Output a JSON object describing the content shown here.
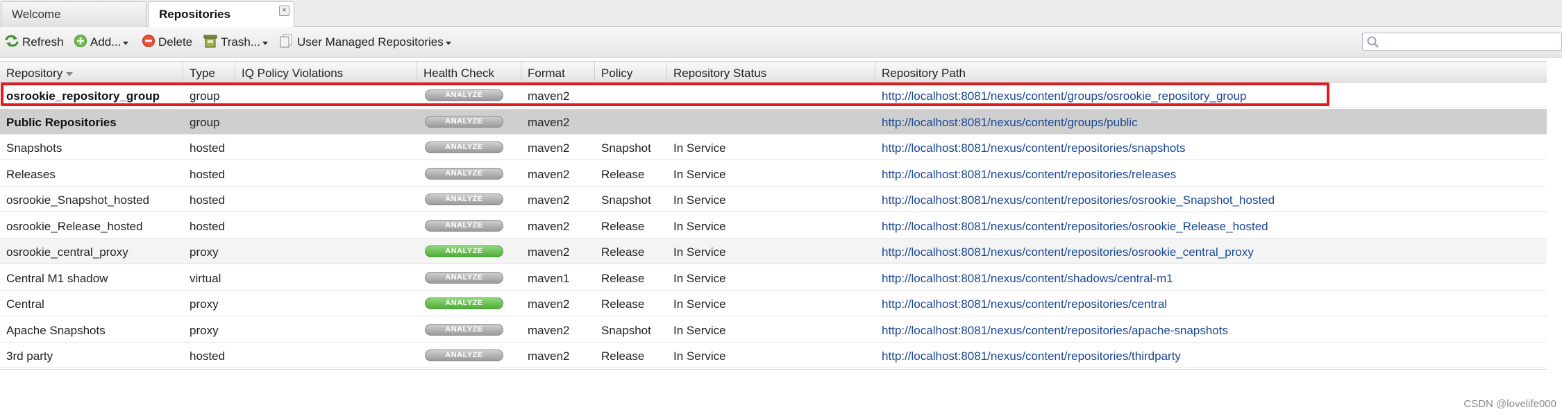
{
  "tabs": [
    {
      "label": "Welcome",
      "active": false
    },
    {
      "label": "Repositories",
      "active": true
    }
  ],
  "toolbar": {
    "refresh_label": "Refresh",
    "add_label": "Add...",
    "delete_label": "Delete",
    "trash_label": "Trash...",
    "user_managed_label": "User Managed Repositories",
    "search_placeholder": ""
  },
  "columns": {
    "repository": "Repository",
    "type": "Type",
    "iq": "IQ Policy Violations",
    "health": "Health Check",
    "format": "Format",
    "policy": "Policy",
    "status": "Repository Status",
    "path": "Repository Path"
  },
  "analyze_label": "ANALYZE",
  "rows": [
    {
      "name": "osrookie_repository_group",
      "type": "group",
      "health": "gray",
      "format": "maven2",
      "policy": "",
      "status": "",
      "path": "http://localhost:8081/nexus/content/groups/osrookie_repository_group"
    },
    {
      "name": "Public Repositories",
      "type": "group",
      "health": "gray",
      "format": "maven2",
      "policy": "",
      "status": "",
      "path": "http://localhost:8081/nexus/content/groups/public"
    },
    {
      "name": "Snapshots",
      "type": "hosted",
      "health": "gray",
      "format": "maven2",
      "policy": "Snapshot",
      "status": "In Service",
      "path": "http://localhost:8081/nexus/content/repositories/snapshots"
    },
    {
      "name": "Releases",
      "type": "hosted",
      "health": "gray",
      "format": "maven2",
      "policy": "Release",
      "status": "In Service",
      "path": "http://localhost:8081/nexus/content/repositories/releases"
    },
    {
      "name": "osrookie_Snapshot_hosted",
      "type": "hosted",
      "health": "gray",
      "format": "maven2",
      "policy": "Snapshot",
      "status": "In Service",
      "path": "http://localhost:8081/nexus/content/repositories/osrookie_Snapshot_hosted"
    },
    {
      "name": "osrookie_Release_hosted",
      "type": "hosted",
      "health": "gray",
      "format": "maven2",
      "policy": "Release",
      "status": "In Service",
      "path": "http://localhost:8081/nexus/content/repositories/osrookie_Release_hosted"
    },
    {
      "name": "osrookie_central_proxy",
      "type": "proxy",
      "health": "green",
      "format": "maven2",
      "policy": "Release",
      "status": "In Service",
      "path": "http://localhost:8081/nexus/content/repositories/osrookie_central_proxy"
    },
    {
      "name": "Central M1 shadow",
      "type": "virtual",
      "health": "gray",
      "format": "maven1",
      "policy": "Release",
      "status": "In Service",
      "path": "http://localhost:8081/nexus/content/shadows/central-m1"
    },
    {
      "name": "Central",
      "type": "proxy",
      "health": "green",
      "format": "maven2",
      "policy": "Release",
      "status": "In Service",
      "path": "http://localhost:8081/nexus/content/repositories/central"
    },
    {
      "name": "Apache Snapshots",
      "type": "proxy",
      "health": "gray",
      "format": "maven2",
      "policy": "Snapshot",
      "status": "In Service",
      "path": "http://localhost:8081/nexus/content/repositories/apache-snapshots"
    },
    {
      "name": "3rd party",
      "type": "hosted",
      "health": "gray",
      "format": "maven2",
      "policy": "Release",
      "status": "In Service",
      "path": "http://localhost:8081/nexus/content/repositories/thirdparty"
    }
  ],
  "watermark": "CSDN @lovelife000",
  "colors": {
    "highlight": "#e8191a",
    "link": "#1a4690",
    "analyze_green": "#4fae3a"
  }
}
